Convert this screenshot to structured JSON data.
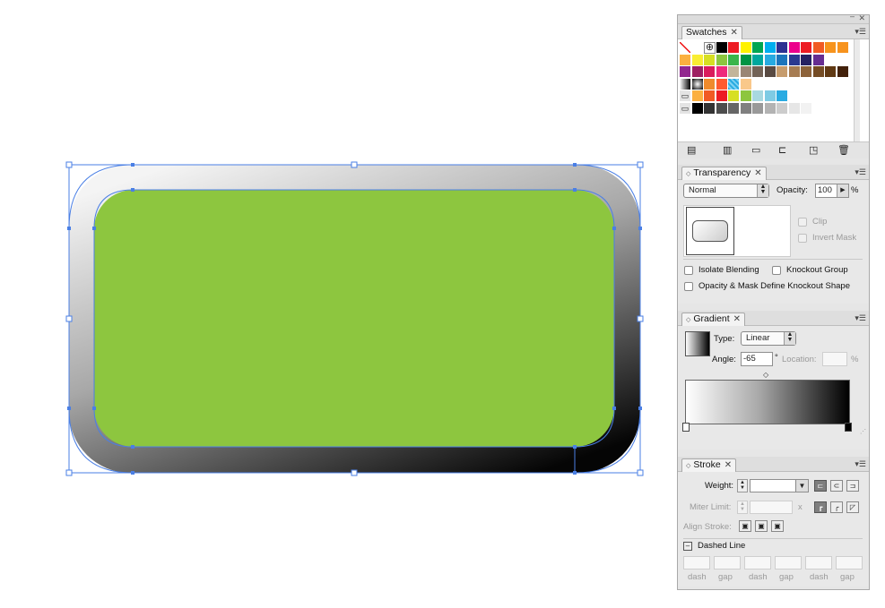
{
  "artwork": {
    "fill_color": "#8dc63f",
    "frame_gradient": [
      "#f4f4f4",
      "#a8a8a8",
      "#050505"
    ],
    "selection_color": "#4a7fe5"
  },
  "swatches": {
    "tab_label": "Swatches",
    "rows": [
      [
        "none",
        "#ffffff",
        "reg",
        "#000000",
        "#ed1c24",
        "#fff200",
        "#00a651",
        "#00aeef",
        "#2e3192",
        "#ec008c",
        "#ed1c24",
        "#f15a24",
        "#f7941d",
        "#f7931e"
      ],
      [
        "#fbb040",
        "#f9ed32",
        "#d7df23",
        "#8dc63f",
        "#39b54a",
        "#009444",
        "#00a79d",
        "#27aae1",
        "#1c75bc",
        "#2b3990",
        "#262262",
        "#662d91"
      ],
      [
        "#92278f",
        "#9e1f63",
        "#da1c5c",
        "#ee2a7b",
        "#c2b59b",
        "#998675",
        "#736357",
        "#594a42",
        "#c69c6d",
        "#a67c52",
        "#8c6239",
        "#754c24",
        "#603913",
        "#42210b"
      ],
      [
        "grad-bw",
        "grad-radial",
        "#ef8b2c",
        "#ff5a2f",
        "pattern-blue",
        "#f9c88a"
      ],
      [
        "folder",
        "#fbb040",
        "#f15a24",
        "#ed1c24",
        "#d7df23",
        "#8dc63f",
        "#a8d8e0",
        "#7ecbe4",
        "#29abe2"
      ],
      [
        "folder",
        "#000000",
        "#333333",
        "#4d4d4d",
        "#666666",
        "#808080",
        "#999999",
        "#b3b3b3",
        "#cccccc",
        "#e6e6e6",
        "#f2f2f2",
        "#ffffff"
      ]
    ]
  },
  "transparency": {
    "tab_label": "Transparency",
    "blend_mode": "Normal",
    "opacity_label": "Opacity:",
    "opacity_value": "100",
    "percent": "%",
    "clip_label": "Clip",
    "invert_mask_label": "Invert Mask",
    "isolate_blending_label": "Isolate Blending",
    "knockout_group_label": "Knockout Group",
    "opacity_mask_label": "Opacity & Mask Define Knockout Shape"
  },
  "gradient": {
    "tab_label": "Gradient",
    "type_label": "Type:",
    "type_value": "Linear",
    "angle_label": "Angle:",
    "angle_value": "-65",
    "location_label": "Location:",
    "location_value": "",
    "percent": "%",
    "degree_mark": "°"
  },
  "stroke": {
    "tab_label": "Stroke",
    "weight_label": "Weight:",
    "weight_value": "",
    "miter_label": "Miter Limit:",
    "miter_value": "",
    "miter_x": "x",
    "align_label": "Align Stroke:",
    "dashed_label": "Dashed Line",
    "dash_labels": [
      "dash",
      "gap",
      "dash",
      "gap",
      "dash",
      "gap"
    ]
  }
}
